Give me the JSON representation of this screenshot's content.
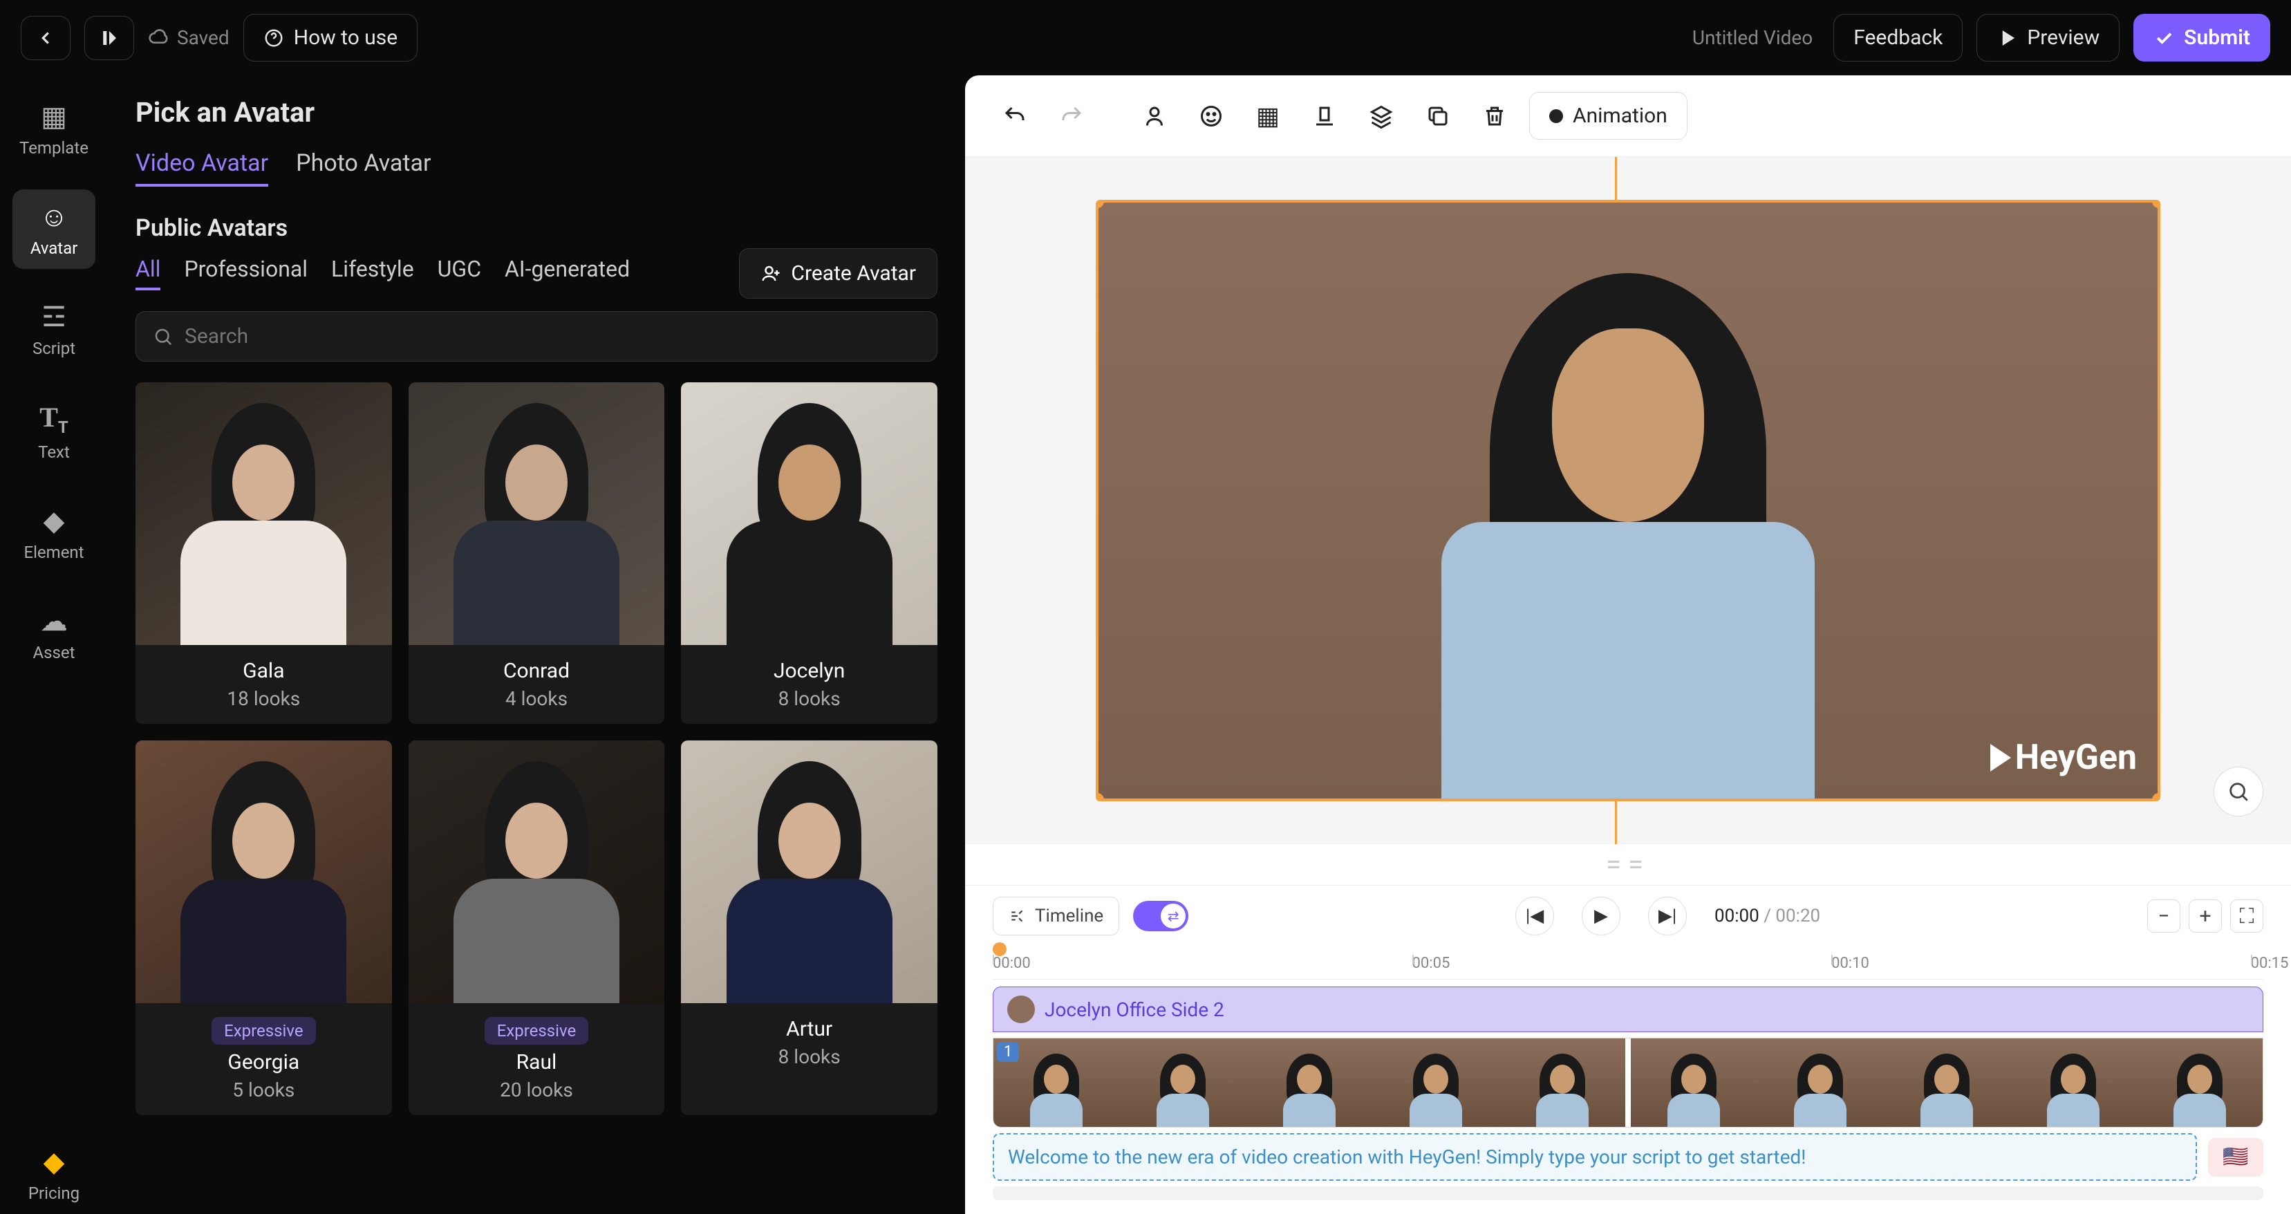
{
  "header": {
    "saved": "Saved",
    "howto": "How to use",
    "docTitle": "Untitled Video",
    "feedback": "Feedback",
    "preview": "Preview",
    "submit": "Submit"
  },
  "rail": {
    "template": "Template",
    "avatar": "Avatar",
    "script": "Script",
    "text": "Text",
    "element": "Element",
    "asset": "Asset",
    "pricing": "Pricing"
  },
  "panel": {
    "title": "Pick an Avatar",
    "tabs": {
      "video": "Video Avatar",
      "photo": "Photo Avatar"
    },
    "createAvatar": "Create Avatar",
    "publicTitle": "Public Avatars",
    "filters": {
      "all": "All",
      "pro": "Professional",
      "life": "Lifestyle",
      "ugc": "UGC",
      "ai": "AI-generated"
    },
    "searchPlaceholder": "Search",
    "expressive": "Expressive",
    "avatars": [
      {
        "name": "Gala",
        "looks": "18 looks",
        "bg": "linear-gradient(150deg,#2a2520,#50443a)",
        "skin": "#d4b095",
        "clothes": "#ece6de"
      },
      {
        "name": "Conrad",
        "looks": "4 looks",
        "bg": "linear-gradient(150deg,#3a3530,#5a5048)",
        "skin": "#c8a88d",
        "clothes": "#2a2f3a"
      },
      {
        "name": "Jocelyn",
        "looks": "8 looks",
        "bg": "linear-gradient(150deg,#d8d4cc,#c0bab0)",
        "skin": "#c89b70",
        "clothes": "#1a1a1a"
      },
      {
        "name": "Georgia",
        "looks": "5 looks",
        "bg": "linear-gradient(150deg,#6a4a38,#3a2a20)",
        "skin": "#d4b095",
        "clothes": "#1a1a2a",
        "expressive": true
      },
      {
        "name": "Raul",
        "looks": "20 looks",
        "bg": "linear-gradient(150deg,#2a2520,#1a1510)",
        "skin": "#d4b095",
        "clothes": "#6a6a6a",
        "expressive": true
      },
      {
        "name": "Artur",
        "looks": "8 looks",
        "bg": "linear-gradient(150deg,#c8c0b4,#a89e90)",
        "skin": "#d4b095",
        "clothes": "#1a2040"
      }
    ]
  },
  "toolbar": {
    "animation": "Animation"
  },
  "watermark": "HeyGen",
  "timeline": {
    "label": "Timeline",
    "current": "00:00",
    "duration": "00:20",
    "ticks": [
      "00:00",
      "00:05",
      "00:10",
      "00:15"
    ],
    "clipLabel": "Jocelyn Office Side 2",
    "clipNum": "1",
    "scriptPlaceholder": "Welcome to the new era of video creation with HeyGen! Simply type your script to get started!",
    "flag": "🇺🇸"
  }
}
